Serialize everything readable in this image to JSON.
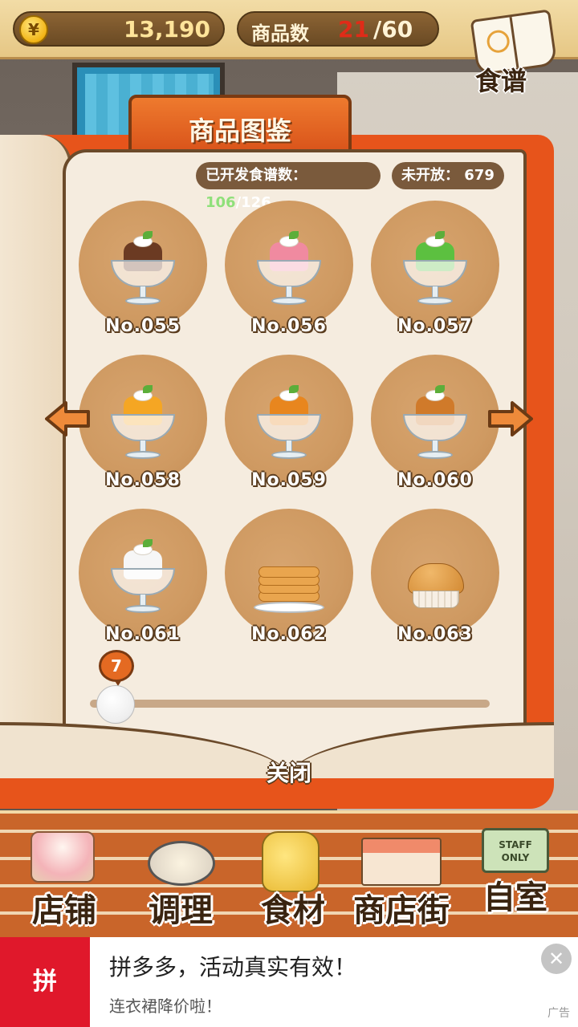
{
  "top": {
    "coin_symbol": "¥",
    "money": "13,190",
    "item_label": "商品数",
    "item_current": "21",
    "item_max": "/60",
    "recipe_label": "食谱"
  },
  "book": {
    "title": "商品图鉴",
    "developed_label": "已开发食谱数：",
    "developed_count": "106",
    "developed_total": "/126",
    "unopened": "未开放： 679",
    "close": "关闭",
    "page": "7"
  },
  "items": [
    {
      "label": "No.055",
      "kind": "pudding",
      "color": "#6b3a22"
    },
    {
      "label": "No.056",
      "kind": "pudding",
      "color": "#f08aa0"
    },
    {
      "label": "No.057",
      "kind": "pudding",
      "color": "#5cc040"
    },
    {
      "label": "No.058",
      "kind": "pudding",
      "color": "#f5a623"
    },
    {
      "label": "No.059",
      "kind": "pudding",
      "color": "#e8861e"
    },
    {
      "label": "No.060",
      "kind": "pudding",
      "color": "#d07a2a"
    },
    {
      "label": "No.061",
      "kind": "pudding",
      "color": "#f6f6f6"
    },
    {
      "label": "No.062",
      "kind": "pancakes",
      "color": "#e9a54e"
    },
    {
      "label": "No.063",
      "kind": "muffin",
      "color": "#d38a34"
    }
  ],
  "nav": [
    {
      "label": "店铺",
      "icon": "cake-icon"
    },
    {
      "label": "调理",
      "icon": "whisk-bowl-icon"
    },
    {
      "label": "食材",
      "icon": "flour-sack-icon"
    },
    {
      "label": "商店街",
      "icon": "storefront-icon"
    },
    {
      "label": "自室",
      "icon": "staff-only-sign-icon",
      "sign": "STAFF ONLY"
    }
  ],
  "ad": {
    "logo": "拼",
    "title": "拼多多，活动真实有效！",
    "subtitle": "连衣裙降价啦！",
    "tag": "广告",
    "close": "✕"
  }
}
